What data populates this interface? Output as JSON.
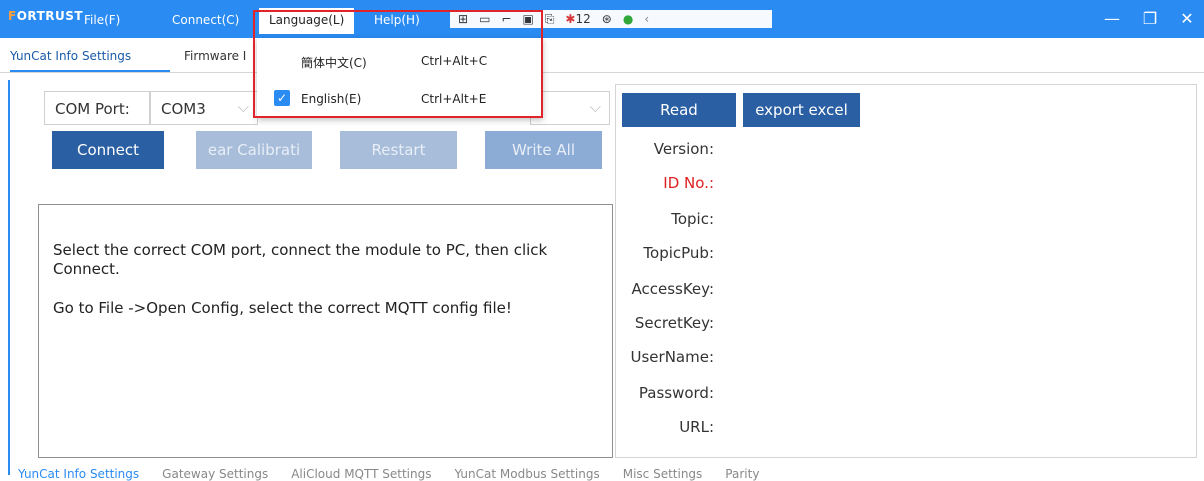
{
  "app": {
    "brand": "FORTRUST",
    "menus": [
      "File(F)",
      "Connect(C)",
      "Language(L)",
      "Help(H)"
    ],
    "tray_badge": "12",
    "window_controls": [
      "minimize-icon",
      "restore-icon",
      "close-icon"
    ]
  },
  "top_tabs": [
    "YunCat Info Settings",
    "Firmware I"
  ],
  "language_menu": {
    "items": [
      {
        "label": "簡体中文(C)",
        "shortcut": "Ctrl+Alt+C",
        "checked": false
      },
      {
        "label": "English(E)",
        "shortcut": "Ctrl+Alt+E",
        "checked": true
      }
    ]
  },
  "left": {
    "com_label": "COM Port:",
    "com_value": "COM3",
    "buttons": [
      "Connect",
      "ear Calibrati",
      "Restart",
      "Write All"
    ],
    "messages": [
      "Select the correct COM port, connect the module to PC, then click Connect.",
      "Go to File ->Open Config, select the correct MQTT config file!"
    ]
  },
  "right": {
    "read_label": "Read",
    "export_label": "export excel",
    "fields": [
      "Version:",
      "ID No.:",
      "Topic:",
      "TopicPub:",
      "AccessKey:",
      "SecretKey:",
      "UserName:",
      "Password:",
      "URL:"
    ]
  },
  "bottom_tabs": [
    "YunCat Info Settings",
    "Gateway Settings",
    "AliCloud MQTT Settings",
    "YunCat Modbus Settings",
    "Misc Settings",
    "Parity"
  ],
  "colors": {
    "accent": "#2a8bf2",
    "button": "#2a5fa3",
    "highlight": "#e0242b"
  }
}
